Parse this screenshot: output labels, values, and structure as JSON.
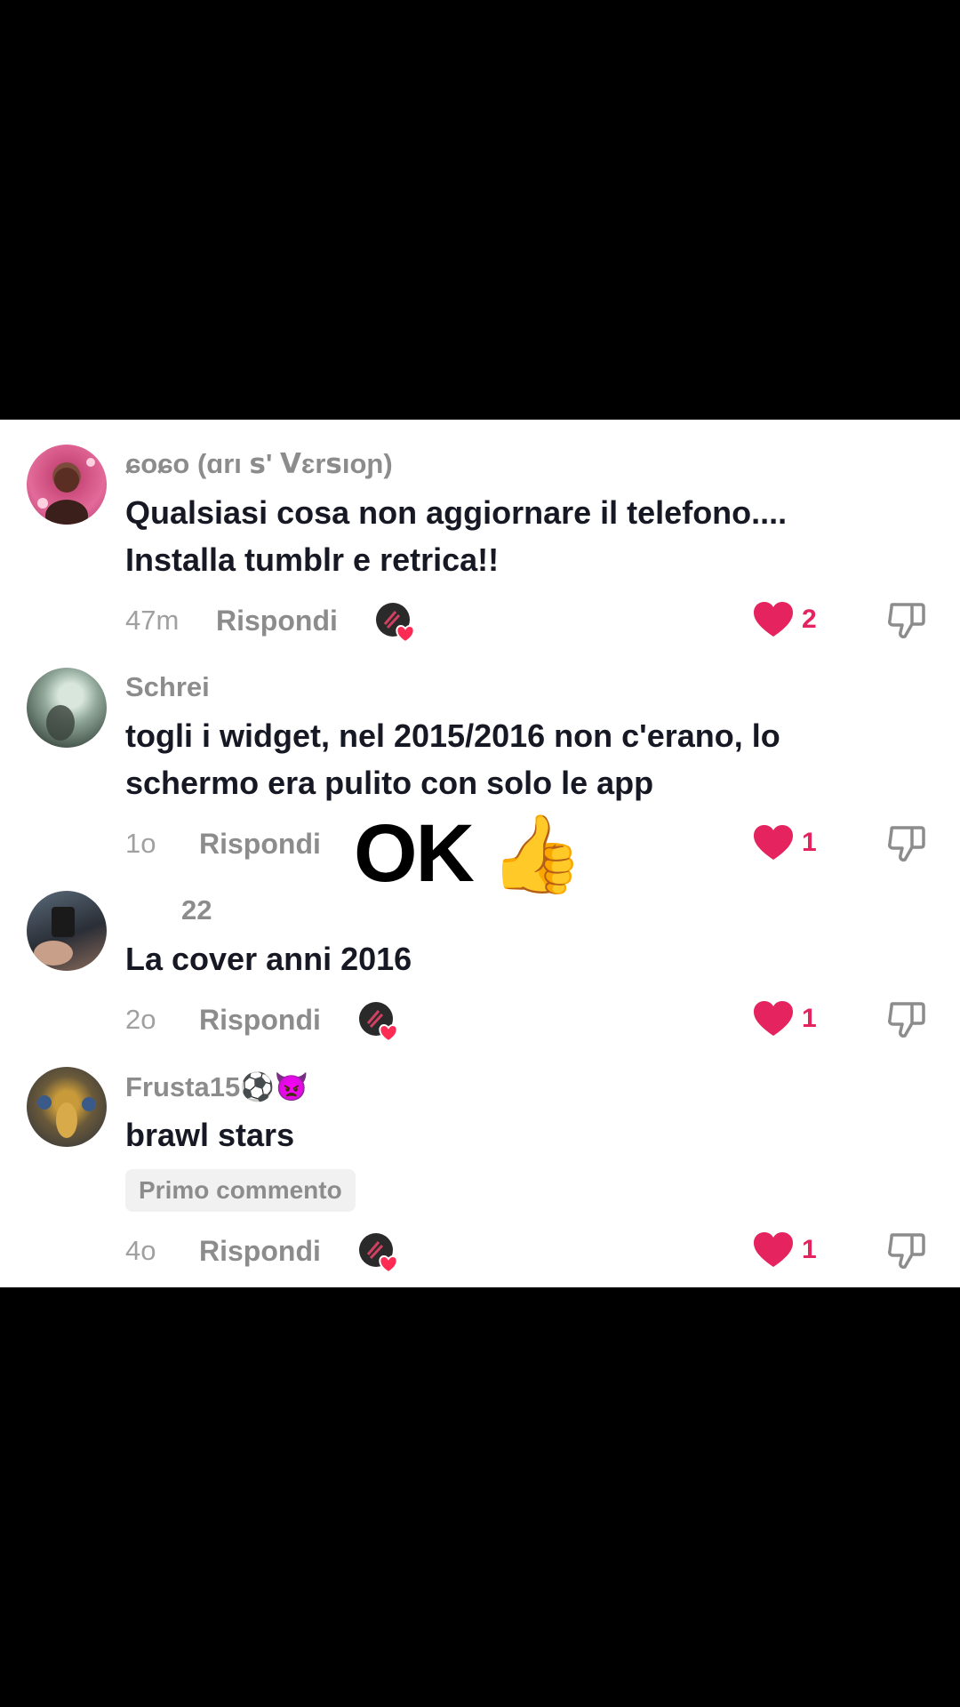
{
  "comments": [
    {
      "username": "ɕoɕo (ɑrı ꜱ' ᐯɛrꜱıoɲ)",
      "text_lines": [
        "Qualsiasi cosa non aggiornare il telefono....",
        "Installa tumblr e retrica!!"
      ],
      "time": "47m",
      "reply_label": "Rispondi",
      "likes": "2",
      "creator_liked": true
    },
    {
      "username": "Schrei",
      "text_lines": [
        "togli i widget, nel 2015/2016 non c'erano, lo",
        "schermo era pulito con solo le app"
      ],
      "time": "1o",
      "reply_label": "Rispondi",
      "likes": "1",
      "creator_liked": false
    },
    {
      "username": "22",
      "text_lines": [
        "La cover anni 2016"
      ],
      "time": "2o",
      "reply_label": "Rispondi",
      "likes": "1",
      "creator_liked": true
    },
    {
      "username": "Frusta15⚽👿",
      "text_lines": [
        "brawl stars"
      ],
      "badge": "Primo commento",
      "time": "4o",
      "reply_label": "Rispondi",
      "likes": "1",
      "creator_liked": true
    }
  ],
  "sticker": {
    "text": "OK",
    "emoji": "👍"
  },
  "colors": {
    "like": "#e5245f",
    "muted": "#8c8c8c",
    "text": "#161823"
  }
}
